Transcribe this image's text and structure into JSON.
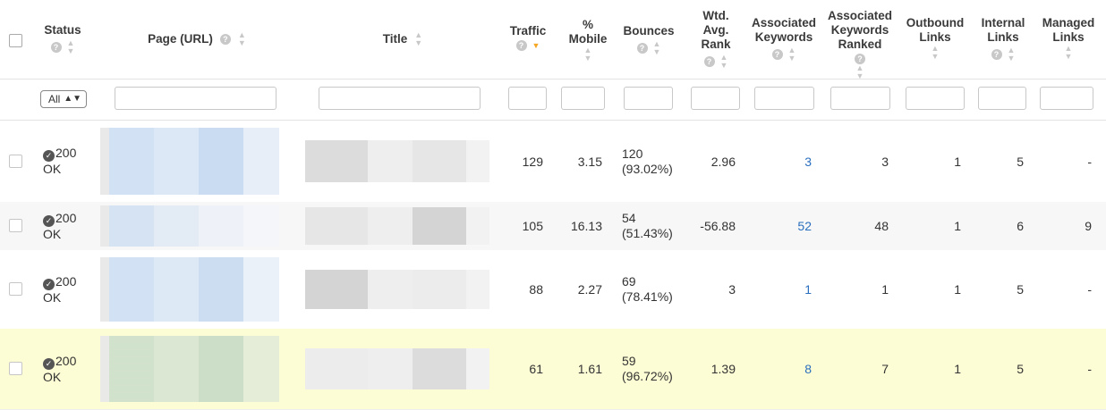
{
  "header": {
    "status": "Status",
    "page_url": "Page (URL)",
    "title": "Title",
    "traffic": "Traffic",
    "pct_mobile_1": "%",
    "pct_mobile_2": "Mobile",
    "bounces": "Bounces",
    "wtd_1": "Wtd.",
    "wtd_2": "Avg.",
    "wtd_3": "Rank",
    "assoc_kw_1": "Associated",
    "assoc_kw_2": "Keywords",
    "assoc_kwr_1": "Associated",
    "assoc_kwr_2": "Keywords",
    "assoc_kwr_3": "Ranked",
    "outbound_1": "Outbound",
    "outbound_2": "Links",
    "internal_1": "Internal",
    "internal_2": "Links",
    "managed_1": "Managed",
    "managed_2": "Links"
  },
  "filter": {
    "status_select": "All"
  },
  "rows": [
    {
      "status_code": "200",
      "status_text": "OK",
      "traffic": "129",
      "mobile": "3.15",
      "bounces": "120",
      "bounces_pct": "(93.02%)",
      "rank": "2.96",
      "assoc_kw": "3",
      "assoc_kwr": "3",
      "outbound": "1",
      "internal": "5",
      "managed": "-"
    },
    {
      "status_code": "200",
      "status_text": "OK",
      "traffic": "105",
      "mobile": "16.13",
      "bounces": "54",
      "bounces_pct": "(51.43%)",
      "rank": "-56.88",
      "assoc_kw": "52",
      "assoc_kwr": "48",
      "outbound": "1",
      "internal": "6",
      "managed": "9"
    },
    {
      "status_code": "200",
      "status_text": "OK",
      "traffic": "88",
      "mobile": "2.27",
      "bounces": "69",
      "bounces_pct": "(78.41%)",
      "rank": "3",
      "assoc_kw": "1",
      "assoc_kwr": "1",
      "outbound": "1",
      "internal": "5",
      "managed": "-"
    },
    {
      "status_code": "200",
      "status_text": "OK",
      "traffic": "61",
      "mobile": "1.61",
      "bounces": "59",
      "bounces_pct": "(96.72%)",
      "rank": "1.39",
      "assoc_kw": "8",
      "assoc_kwr": "7",
      "outbound": "1",
      "internal": "5",
      "managed": "-"
    }
  ],
  "colors": {
    "link": "#2a6fbe",
    "sort_active": "#f5a623",
    "row_alt": "#f7f7f7",
    "row_highlight": "#fdfdd5"
  }
}
